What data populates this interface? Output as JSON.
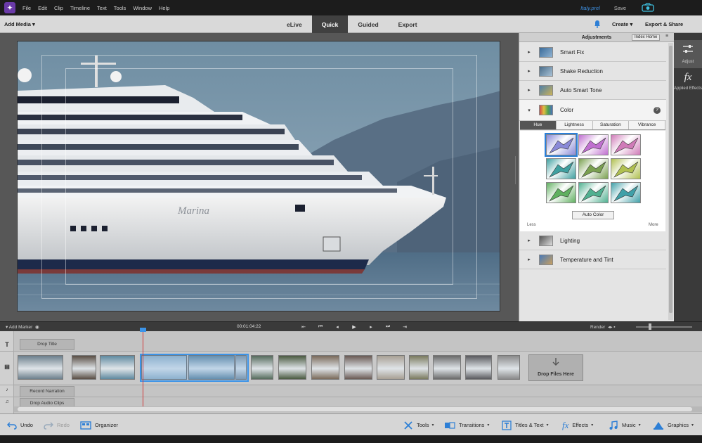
{
  "app": {
    "menu": [
      "File",
      "Edit",
      "Clip",
      "Timeline",
      "Text",
      "Tools",
      "Window",
      "Help"
    ],
    "file_name": "Italy.prel",
    "save_label": "Save"
  },
  "modebar": {
    "add_media": "Add Media",
    "tabs": [
      {
        "label": "eLive",
        "active": false
      },
      {
        "label": "Quick",
        "active": true
      },
      {
        "label": "Guided",
        "active": false
      },
      {
        "label": "Export",
        "active": false
      }
    ],
    "create": "Create",
    "export_share": "Export & Share"
  },
  "adjustments": {
    "title": "Adjustments",
    "help_button": "Index Home",
    "items": [
      {
        "label": "Smart Fix",
        "expanded": false
      },
      {
        "label": "Shake Reduction",
        "expanded": false
      },
      {
        "label": "Auto Smart Tone",
        "expanded": false
      },
      {
        "label": "Color",
        "expanded": true
      },
      {
        "label": "Lighting",
        "expanded": false
      },
      {
        "label": "Temperature and Tint",
        "expanded": false
      }
    ],
    "color_tabs": [
      {
        "label": "Hue",
        "active": true
      },
      {
        "label": "Lightness",
        "active": false
      },
      {
        "label": "Saturation",
        "active": false
      },
      {
        "label": "Vibrance",
        "active": false
      }
    ],
    "auto_color": "Auto Color",
    "less_label": "Less",
    "more_label": "More",
    "swatch_colors": [
      "#8a8ad8",
      "#c070d0",
      "#d07ab8",
      "#3fa0a0",
      "#7aa050",
      "#b0c050",
      "#60b060",
      "#50b090",
      "#40a0a8"
    ]
  },
  "right_tools": [
    {
      "label": "Adjust",
      "icon": "sliders-icon",
      "active": true
    },
    {
      "label": "Applied Effects",
      "icon": "fx-icon",
      "active": false
    }
  ],
  "timeline": {
    "add_marker": "Add Marker",
    "timecode": "00:01:04:22",
    "render": "Render"
  },
  "tracks": {
    "title_drop": "Drop Title",
    "narration": "Record Narration",
    "audio_drop": "Drop Audio Clips",
    "drop_files": "Drop Files Here",
    "video_icon": "T",
    "clip_colors": [
      "#6c7f8c",
      "#5a4e44",
      "#5f8aa0",
      "#9fb7c9",
      "#6e8ea3",
      "#8a9aa7",
      "#556b5c",
      "#4a5a40",
      "#7a6a5a",
      "#6a5a54",
      "#a8a094",
      "#7a7a5e",
      "#6a6a6a",
      "#5a5a5e",
      "#8a8a8a"
    ]
  },
  "bottombar": {
    "undo": "Undo",
    "redo": "Redo",
    "organizer": "Organizer",
    "tools": "Tools",
    "transitions": "Transitions",
    "titles_text": "Titles & Text",
    "effects": "Effects",
    "music": "Music",
    "graphics": "Graphics"
  },
  "preview": {
    "ship_name": "Marina",
    "sky_color": "#7d98ab",
    "sea_color": "#5d7a92",
    "mountain_color": "#5c7086"
  }
}
